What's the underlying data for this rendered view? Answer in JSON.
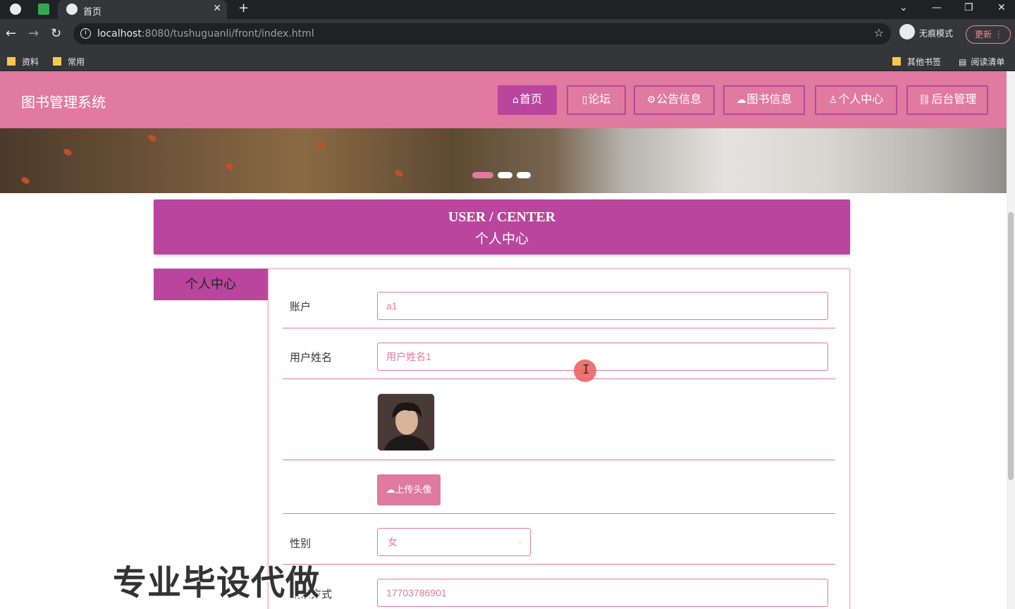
{
  "browser": {
    "tab_title": "首页",
    "url_host": "localhost",
    "url_rest": ":8080/tushuguanli/front/index.html",
    "incognito_label": "无痕模式",
    "update_label": "更新",
    "bookmarks": [
      "资料",
      "常用"
    ],
    "bookmarks_right": [
      "其他书签",
      "阅读清单"
    ]
  },
  "site": {
    "title": "图书管理系统",
    "nav": [
      {
        "label": "首页",
        "icon": "home-icon",
        "glyph": "⌂",
        "active": true
      },
      {
        "label": "论坛",
        "icon": "forum-icon",
        "glyph": "▯",
        "active": false
      },
      {
        "label": "公告信息",
        "icon": "announcement-icon",
        "glyph": "⚙",
        "active": false
      },
      {
        "label": "图书信息",
        "icon": "cloud-icon",
        "glyph": "☁",
        "active": false
      },
      {
        "label": "个人中心",
        "icon": "user-icon",
        "glyph": "ᵒ",
        "active": false
      },
      {
        "label": "后台管理",
        "icon": "link-icon",
        "glyph": "⛓",
        "active": false
      }
    ]
  },
  "user_center": {
    "title_en": "USER / CENTER",
    "title_cn": "个人中心",
    "side_tab": "个人中心"
  },
  "form": {
    "account_label": "账户",
    "account_value": "a1",
    "name_label": "用户姓名",
    "name_value": "用户姓名1",
    "upload_label": "上传头像",
    "gender_label": "性别",
    "gender_value": "女",
    "phone_label": "联系方式",
    "phone_value": "17703786901"
  },
  "watermark": "专业毕设代做",
  "colors": {
    "accent": "#e07a9f",
    "accent_dark": "#b9469c"
  }
}
